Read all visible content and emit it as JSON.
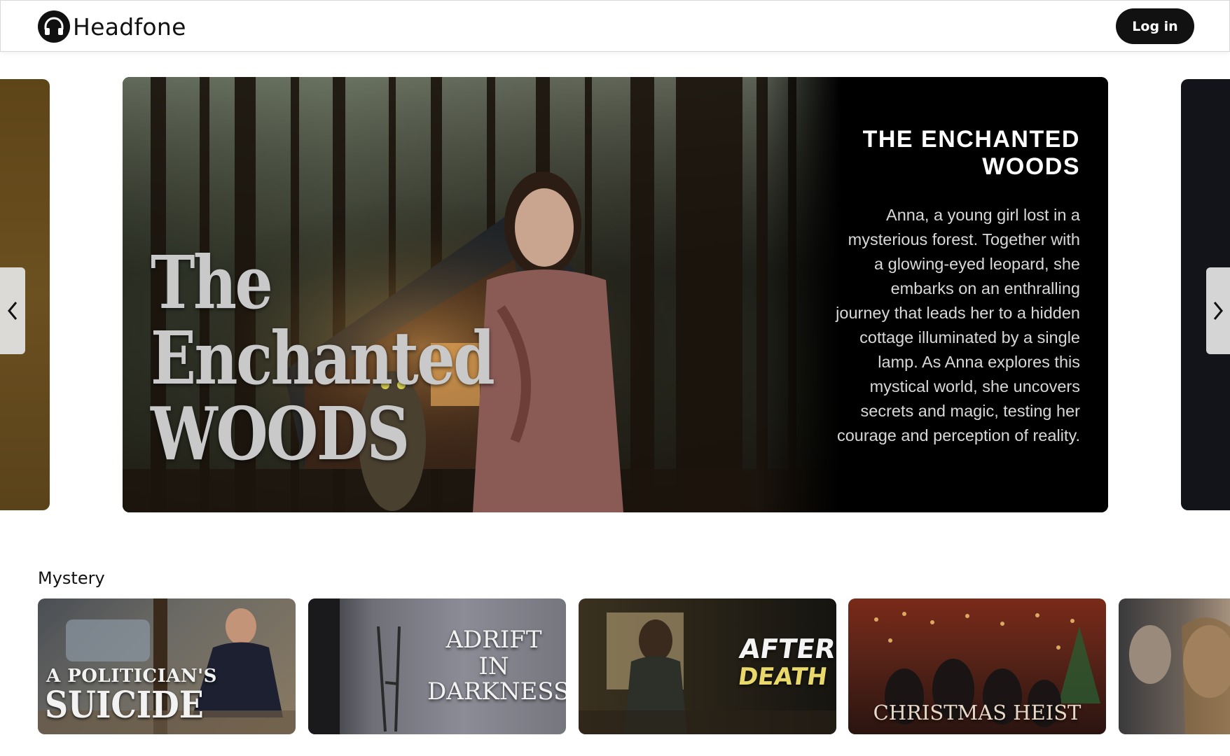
{
  "brand": {
    "name": "Headfone",
    "icon": "headphones-icon"
  },
  "header": {
    "login_label": "Log in"
  },
  "hero": {
    "art_title_lines": [
      "The",
      "Enchanted",
      "WOODS"
    ],
    "heading": "THE ENCHANTED WOODS",
    "description": "Anna, a young girl lost in a mysterious forest. Together with a glowing-eyed leopard, she embarks on an enthralling journey that leads her to a hidden cottage illuminated by a single lamp. As Anna explores this mystical world, she uncovers secrets and magic, testing her courage and perception of reality."
  },
  "carousel": {
    "prev_icon": "chevron-left-icon",
    "next_icon": "chevron-right-icon"
  },
  "sections": [
    {
      "title": "Mystery",
      "items": [
        {
          "line1": "A POLITICIAN'S",
          "line2": "SUICIDE"
        },
        {
          "line1": "ADRIFT",
          "line2": "IN",
          "line3": "DARKNESS"
        },
        {
          "line1": "AFTER",
          "line2": "DEATH"
        },
        {
          "line1": "CHRISTMAS HEIST"
        },
        {
          "line1": ""
        }
      ]
    }
  ],
  "colors": {
    "brand_dark": "#111111",
    "hero_bg": "#000000",
    "left_card": "#6b5020",
    "right_card": "#12141a"
  }
}
